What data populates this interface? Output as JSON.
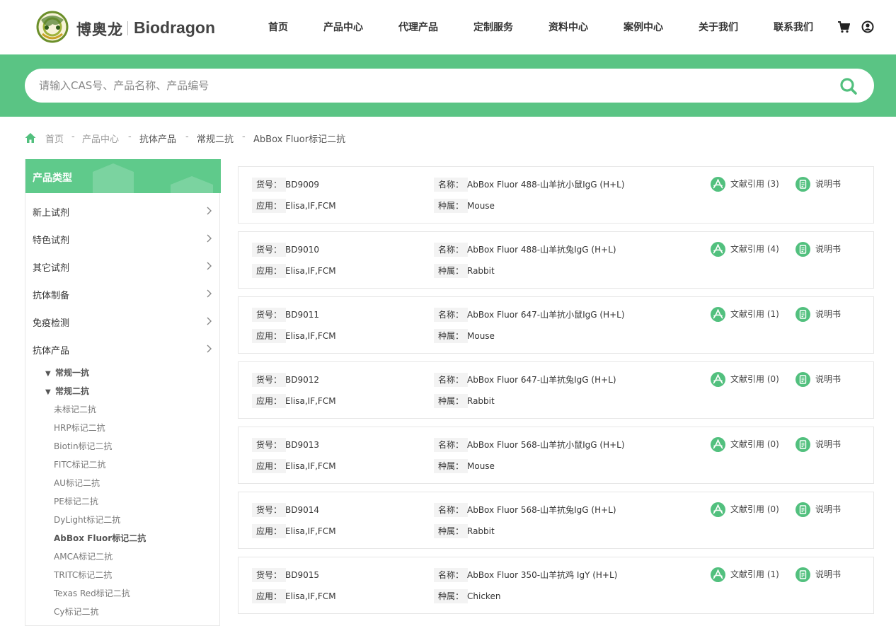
{
  "header": {
    "brand_cn": "博奥龙",
    "brand_en": "Biodragon",
    "nav": [
      "首页",
      "产品中心",
      "代理产品",
      "定制服务",
      "资料中心",
      "案例中心",
      "关于我们",
      "联系我们"
    ]
  },
  "search": {
    "placeholder": "请输入CAS号、产品名称、产品编号"
  },
  "breadcrumb": [
    "首页",
    "产品中心",
    "抗体产品",
    "常规二抗",
    "AbBox Fluor标记二抗"
  ],
  "breadcrumb_sep": "-",
  "sidebar": {
    "title": "产品类型",
    "categories": [
      "新上试剂",
      "特色试剂",
      "其它试剂",
      "抗体制备",
      "免疫检测",
      "抗体产品"
    ],
    "subgroups": [
      "常规一抗",
      "常规二抗"
    ],
    "items": [
      "未标记二抗",
      "HRP标记二抗",
      "Biotin标记二抗",
      "FITC标记二抗",
      "AU标记二抗",
      "PE标记二抗",
      "DyLight标记二抗",
      "AbBox Fluor标记二抗",
      "AMCA标记二抗",
      "TRITC标记二抗",
      "Texas Red标记二抗",
      "Cy标记二抗"
    ],
    "active_item": "AbBox Fluor标记二抗"
  },
  "labels": {
    "sku": "货号",
    "name": "名称",
    "app": "应用",
    "species": "种属",
    "colon": "：",
    "manual": "说明书"
  },
  "products": [
    {
      "sku": "BD9009",
      "name": "AbBox Fluor 488-山羊抗小鼠IgG (H+L)",
      "app": "Elisa,IF,FCM",
      "species": "Mouse",
      "cite": "文献引用 (3)"
    },
    {
      "sku": "BD9010",
      "name": "AbBox Fluor 488-山羊抗兔IgG (H+L)",
      "app": "Elisa,IF,FCM",
      "species": "Rabbit",
      "cite": "文献引用 (4)"
    },
    {
      "sku": "BD9011",
      "name": "AbBox Fluor 647-山羊抗小鼠IgG (H+L)",
      "app": "Elisa,IF,FCM",
      "species": "Mouse",
      "cite": "文献引用 (1)"
    },
    {
      "sku": "BD9012",
      "name": "AbBox Fluor 647-山羊抗兔IgG (H+L)",
      "app": "Elisa,IF,FCM",
      "species": "Rabbit",
      "cite": "文献引用 (0)"
    },
    {
      "sku": "BD9013",
      "name": "AbBox Fluor 568-山羊抗小鼠IgG (H+L)",
      "app": "Elisa,IF,FCM",
      "species": "Mouse",
      "cite": "文献引用 (0)"
    },
    {
      "sku": "BD9014",
      "name": "AbBox Fluor 568-山羊抗兔IgG (H+L)",
      "app": "Elisa,IF,FCM",
      "species": "Rabbit",
      "cite": "文献引用 (0)"
    },
    {
      "sku": "BD9015",
      "name": "AbBox Fluor 350-山羊抗鸡 IgY (H+L)",
      "app": "Elisa,IF,FCM",
      "species": "Chicken",
      "cite": "文献引用 (1)"
    }
  ],
  "colors": {
    "brand_green": "#5ac484",
    "icon_green": "#52c07e"
  },
  "icons": {
    "cart": "cart-icon",
    "user": "user-icon",
    "search": "search-icon",
    "home": "home-icon",
    "pdf": "pdf-icon",
    "manual": "manual-icon",
    "chevron": "chevron-right-icon"
  }
}
